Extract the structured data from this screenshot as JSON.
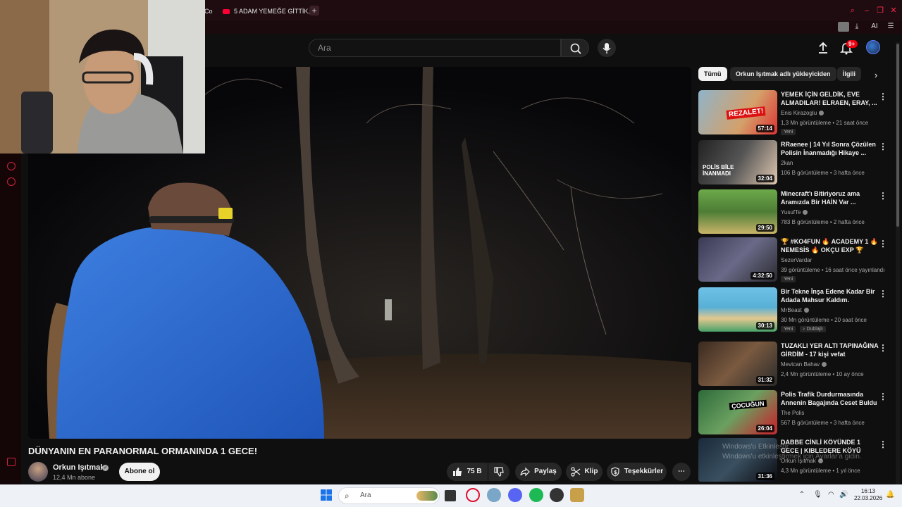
{
  "browser": {
    "tabs": [
      {
        "label": "Co"
      },
      {
        "label": "5 ADAM YEMEĞE GİTTİK,"
      }
    ],
    "toolbar_ai_label": "AI"
  },
  "header": {
    "search_placeholder": "Ara",
    "notifications_count": "9+"
  },
  "video": {
    "title": "DÜNYANIN EN PARANORMAL ORMANINDA 1 GECE!",
    "channel": "Orkun Işıtmak",
    "subscribers": "12,4 Mn abone",
    "subscribe_label": "Abone ol",
    "likes": "75 B",
    "share_label": "Paylaş",
    "clip_label": "Klip",
    "thanks_label": "Teşekkürler"
  },
  "chips": [
    {
      "label": "Tümü"
    },
    {
      "label": "Orkun Işıtmak adlı yükleyiciden"
    },
    {
      "label": "İlgili"
    }
  ],
  "recommendations": [
    {
      "title": "YEMEK İÇİN GELDİK, EVE ALMADILAR! ELRAEN, ERAY, ...",
      "channel": "Enis Kirazoglu",
      "meta": "1,3 Mn görüntüleme • 21 saat önce",
      "duration": "57:14",
      "badge": "Yeni",
      "thumb_text": "REZALET!"
    },
    {
      "title": "RRaenee | 14 Yıl Sonra Çözülen Polisin İnanmadığı Hikaye ...",
      "channel": "2kan",
      "meta": "106 B görüntüleme • 3 hafta önce",
      "duration": "32:04",
      "badge": "",
      "thumb_text": "POLİS BİLE İNANMADI"
    },
    {
      "title": "Minecraft'ı Bitiriyoruz ama Aramızda Bir HAİN Var ...",
      "channel": "YusufTe",
      "meta": "783 B görüntüleme • 2 hafta önce",
      "duration": "29:50",
      "badge": "",
      "thumb_text": ""
    },
    {
      "title": "🏆 #KO4FUN 🔥 ACADEMY 1 🔥 NEMESİS 🔥 OKÇU EXP 🏆",
      "channel": "SezerVardar",
      "meta": "39 görüntüleme • 16 saat önce yayınlandı",
      "duration": "4:32:50",
      "badge": "Yeni",
      "thumb_text": ""
    },
    {
      "title": "Bir Tekne İnşa Edene Kadar Bir Adada Mahsur Kaldım.",
      "channel": "MrBeast",
      "meta": "30 Mn görüntüleme • 20 saat önce",
      "duration": "30:13",
      "badge": "Yeni",
      "badge2": "Dublajlı",
      "thumb_text": ""
    },
    {
      "title": "TUZAKLI YER ALTI TAPINAĞINA GİRDİM - 17 kişi vefat",
      "channel": "Mevtcan Bahav",
      "meta": "2,4 Mn görüntüleme • 10 ay önce",
      "duration": "31:32",
      "badge": "",
      "thumb_text": ""
    },
    {
      "title": "Polis Trafik Durdurmasında Annenin Bagajında Ceset Buldu",
      "channel": "The Polis",
      "meta": "567 B görüntüleme • 3 hafta önce",
      "duration": "26:04",
      "badge": "",
      "thumb_text": "ÇOCUĞUN"
    },
    {
      "title": "DABBE CİNLİ KÖYÜNDE 1 GECE | KIBLEDERE KÖYÜ",
      "channel": "Orkun Işıtmak",
      "meta": "4,3 Mn görüntüleme • 1 yıl önce",
      "duration": "31:36",
      "badge": "",
      "thumb_text": ""
    }
  ],
  "watermark": {
    "line1": "Windows'u Etkinleştir",
    "line2": "Windows'u etkinleştirmek için Ayarlar'a gidin."
  },
  "taskbar": {
    "search_label": "Ara",
    "time": "16:13",
    "date": "22.03.2026"
  }
}
